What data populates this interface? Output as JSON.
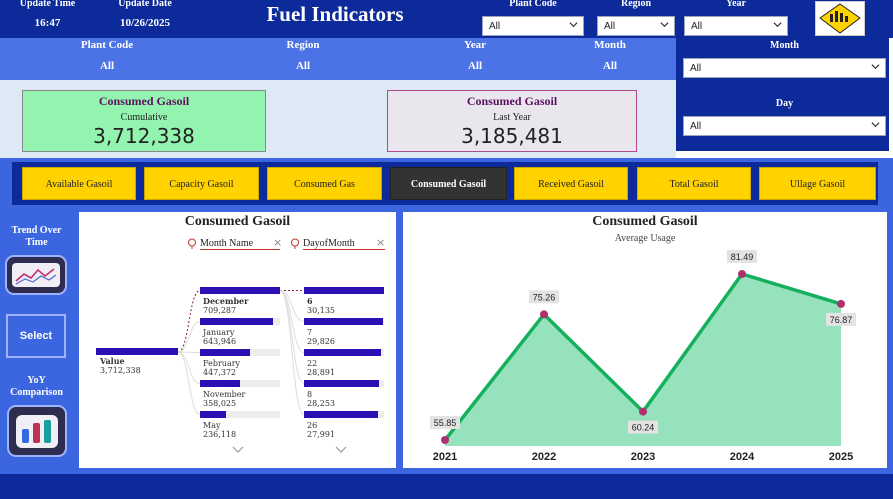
{
  "header": {
    "update_time_label": "Update Time",
    "update_time": "16:47",
    "update_date_label": "Update Date",
    "update_date": "10/26/2025",
    "title": "Fuel Indicators",
    "plant_code_label": "Plant Code",
    "plant_code_value": "All",
    "region_label": "Region",
    "region_value": "All",
    "year_label": "Year",
    "year_value": "All"
  },
  "filters": [
    {
      "label": "Plant Code",
      "value": "All"
    },
    {
      "label": "Region",
      "value": "All"
    },
    {
      "label": "Year",
      "value": "All"
    },
    {
      "label": "Month",
      "value": "All"
    }
  ],
  "right_panel": {
    "month_label": "Month",
    "month_value": "All",
    "day_label": "Day",
    "day_value": "All"
  },
  "kpis": [
    {
      "title": "Consumed Gasoil",
      "subtitle": "Cumulative",
      "value": "3,712,338",
      "bg": "#92f4ae"
    },
    {
      "title": "Consumed Gasoil",
      "subtitle": "Last Year",
      "value": "3,185,481",
      "bg": "#e9e6ee"
    }
  ],
  "tabs": [
    {
      "label": "Available Gasoil",
      "active": false
    },
    {
      "label": "Capacity Gasoil",
      "active": false
    },
    {
      "label": "Consumed Gas",
      "active": false
    },
    {
      "label": "Consumed Gasoil",
      "active": true
    },
    {
      "label": "Received Gasoil",
      "active": false
    },
    {
      "label": "Total Gasoil",
      "active": false
    },
    {
      "label": "Ullage Gasoil",
      "active": false
    }
  ],
  "nav": {
    "trend_label": "Trend Over Time",
    "select_label": "Select",
    "yoy_label": "YoY Comparison"
  },
  "decomposition": {
    "title": "Consumed Gasoil",
    "level1_field": "Month Name",
    "level2_field": "DayofMonth",
    "root": {
      "label": "Value",
      "value": "3,712,338"
    },
    "months": [
      {
        "name": "December",
        "value": "709,287",
        "fraction": 1.0,
        "selected": true
      },
      {
        "name": "January",
        "value": "643,946",
        "fraction": 0.91,
        "selected": false
      },
      {
        "name": "February",
        "value": "447,372",
        "fraction": 0.63,
        "selected": false
      },
      {
        "name": "November",
        "value": "358,025",
        "fraction": 0.5,
        "selected": false
      },
      {
        "name": "May",
        "value": "236,118",
        "fraction": 0.33,
        "selected": false
      }
    ],
    "days": [
      {
        "name": "6",
        "value": "30,135",
        "fraction": 1.0
      },
      {
        "name": "7",
        "value": "29,826",
        "fraction": 0.99
      },
      {
        "name": "22",
        "value": "28,891",
        "fraction": 0.96
      },
      {
        "name": "8",
        "value": "28,253",
        "fraction": 0.94
      },
      {
        "name": "26",
        "value": "27,991",
        "fraction": 0.93
      }
    ]
  },
  "line_chart": {
    "title": "Consumed Gasoil",
    "subtitle": "Average Usage"
  },
  "chart_data": {
    "type": "area",
    "title": "Consumed Gasoil",
    "subtitle": "Average Usage",
    "categories": [
      "2021",
      "2022",
      "2023",
      "2024",
      "2025"
    ],
    "values": [
      55.85,
      75.26,
      60.24,
      81.49,
      76.87
    ],
    "labels": [
      "55.85",
      "75.26",
      "60.24",
      "81.49",
      "76.87"
    ],
    "ylim": [
      55.85,
      81.49
    ],
    "grid": false,
    "line_color": "#14b05c",
    "fill_color": "#95e2bd",
    "marker_color": "#b0306e"
  },
  "colors": {
    "header_blue": "#0d2a9a",
    "band_blue": "#4b73e6",
    "tab_yellow": "#ffd200",
    "bar_blue": "#2b0fb3"
  }
}
